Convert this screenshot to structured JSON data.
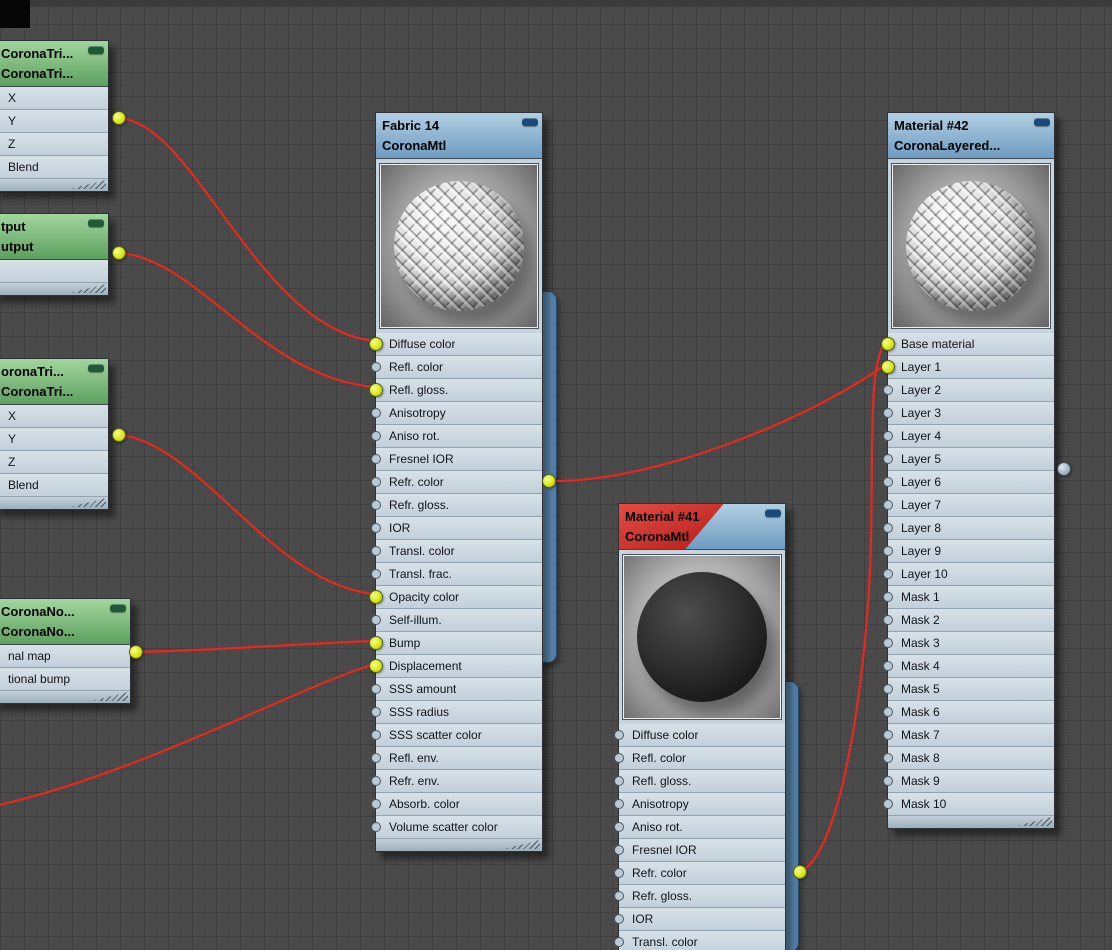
{
  "editor": {
    "background_color": "#4a4a4a",
    "wire_color": "#e8281e",
    "connected_dot_color": "#d9e719",
    "node_body_color": "#c8d4dd",
    "green_header_color": "#7fbf7f",
    "blue_header_color": "#8fb6d4",
    "red_header_color": "#c01818"
  },
  "nodes": {
    "tri1": {
      "title1": "CoronaTri...",
      "title2": "CoronaTri...",
      "slots": [
        {
          "label": "X",
          "connected": false
        },
        {
          "label": "Y",
          "connected": false
        },
        {
          "label": "Z",
          "connected": false
        },
        {
          "label": "Blend",
          "connected": false
        }
      ]
    },
    "output": {
      "title1": "tput",
      "title2": "utput",
      "slots": [
        {
          "label": "",
          "connected": false
        }
      ]
    },
    "tri2": {
      "title1": "oronaTri...",
      "title2": "CoronaTri...",
      "slots": [
        {
          "label": "X",
          "connected": false
        },
        {
          "label": "Y",
          "connected": false
        },
        {
          "label": "Z",
          "connected": false
        },
        {
          "label": "Blend",
          "connected": false
        }
      ]
    },
    "norm": {
      "title1": "CoronaNo...",
      "title2": "CoronaNo...",
      "slots": [
        {
          "label": "nal map",
          "connected": false
        },
        {
          "label": "tional bump",
          "connected": false
        }
      ]
    },
    "fabric": {
      "title1": "Fabric 14",
      "title2": "CoronaMtl",
      "slots": [
        {
          "label": "Diffuse color",
          "connected": true
        },
        {
          "label": "Refl. color",
          "connected": false
        },
        {
          "label": "Refl. gloss.",
          "connected": true
        },
        {
          "label": "Anisotropy",
          "connected": false
        },
        {
          "label": "Aniso rot.",
          "connected": false
        },
        {
          "label": "Fresnel IOR",
          "connected": false
        },
        {
          "label": "Refr. color",
          "connected": false
        },
        {
          "label": "Refr. gloss.",
          "connected": false
        },
        {
          "label": "IOR",
          "connected": false
        },
        {
          "label": "Transl. color",
          "connected": false
        },
        {
          "label": "Transl. frac.",
          "connected": false
        },
        {
          "label": "Opacity color",
          "connected": true
        },
        {
          "label": "Self-illum.",
          "connected": false
        },
        {
          "label": "Bump",
          "connected": true
        },
        {
          "label": "Displacement",
          "connected": true
        },
        {
          "label": "SSS amount",
          "connected": false
        },
        {
          "label": "SSS radius",
          "connected": false
        },
        {
          "label": "SSS scatter color",
          "connected": false
        },
        {
          "label": "Refl. env.",
          "connected": false
        },
        {
          "label": "Refr. env.",
          "connected": false
        },
        {
          "label": "Absorb. color",
          "connected": false
        },
        {
          "label": "Volume scatter color",
          "connected": false
        }
      ]
    },
    "mat41": {
      "title1": "Material #41",
      "title2": "CoronaMtl",
      "slots": [
        {
          "label": "Diffuse color",
          "connected": false
        },
        {
          "label": "Refl. color",
          "connected": false
        },
        {
          "label": "Refl. gloss.",
          "connected": false
        },
        {
          "label": "Anisotropy",
          "connected": false
        },
        {
          "label": "Aniso rot.",
          "connected": false
        },
        {
          "label": "Fresnel IOR",
          "connected": false
        },
        {
          "label": "Refr. color",
          "connected": false
        },
        {
          "label": "Refr. gloss.",
          "connected": false
        },
        {
          "label": "IOR",
          "connected": false
        },
        {
          "label": "Transl. color",
          "connected": false
        }
      ]
    },
    "mat42": {
      "title1": "Material #42",
      "title2": "CoronaLayered...",
      "slots": [
        {
          "label": "Base material",
          "connected": true
        },
        {
          "label": "Layer 1",
          "connected": true
        },
        {
          "label": "Layer 2",
          "connected": false
        },
        {
          "label": "Layer 3",
          "connected": false
        },
        {
          "label": "Layer 4",
          "connected": false
        },
        {
          "label": "Layer 5",
          "connected": false
        },
        {
          "label": "Layer 6",
          "connected": false
        },
        {
          "label": "Layer 7",
          "connected": false
        },
        {
          "label": "Layer 8",
          "connected": false
        },
        {
          "label": "Layer 9",
          "connected": false
        },
        {
          "label": "Layer 10",
          "connected": false
        },
        {
          "label": "Mask 1",
          "connected": false
        },
        {
          "label": "Mask 2",
          "connected": false
        },
        {
          "label": "Mask 3",
          "connected": false
        },
        {
          "label": "Mask 4",
          "connected": false
        },
        {
          "label": "Mask 5",
          "connected": false
        },
        {
          "label": "Mask 6",
          "connected": false
        },
        {
          "label": "Mask 7",
          "connected": false
        },
        {
          "label": "Mask 8",
          "connected": false
        },
        {
          "label": "Mask 9",
          "connected": false
        },
        {
          "label": "Mask 10",
          "connected": false
        }
      ]
    }
  },
  "connections": [
    {
      "from": "CoronaTri... (top)",
      "to": "Fabric 14 / Diffuse color"
    },
    {
      "from": "utput",
      "to": "Fabric 14 / Refl. gloss."
    },
    {
      "from": "CoronaTri... (middle)",
      "to": "Fabric 14 / Opacity color"
    },
    {
      "from": "CoronaNo...",
      "to": "Fabric 14 / Bump"
    },
    {
      "from": "off-screen lower-left",
      "to": "Fabric 14 / Displacement"
    },
    {
      "from": "Fabric 14",
      "to": "Material #42 / Layer 1"
    },
    {
      "from": "Material #41",
      "to": "Material #42 / Base material"
    }
  ]
}
